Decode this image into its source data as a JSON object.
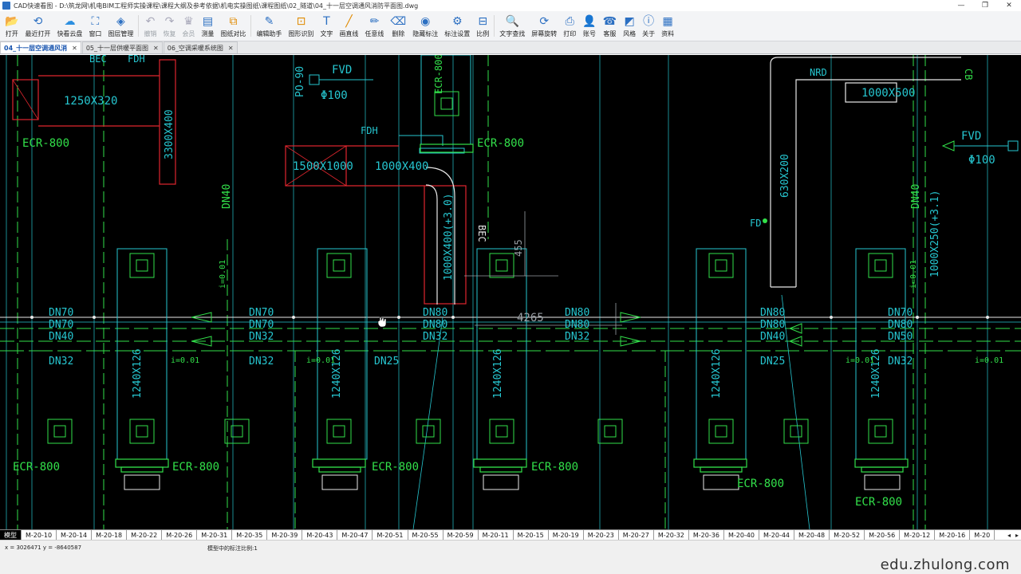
{
  "window": {
    "title": "CAD快速看图 - D:\\筑龙网\\机电BIM工程师实操课程\\课程大纲及参考依据\\机电实操图纸\\课程图纸\\02_隧道\\04_十一层空调通风消防平面图.dwg",
    "min_label": "—",
    "max_label": "❐",
    "close_label": "✕"
  },
  "toolbar": {
    "items": [
      {
        "label": "打开",
        "icon": "folder-icon",
        "glyph": "📂",
        "color": "#2b6fc2"
      },
      {
        "label": "最近打开",
        "icon": "history-icon",
        "glyph": "⟲",
        "color": "#2b6fc2"
      },
      {
        "label": "快看云盘",
        "icon": "cloud-icon",
        "glyph": "☁",
        "color": "#2b8fe0"
      },
      {
        "label": "窗口",
        "icon": "window-icon",
        "glyph": "⛶",
        "color": "#2b6fc2"
      },
      {
        "label": "图层管理",
        "icon": "layers-icon",
        "glyph": "◈",
        "color": "#2b6fc2"
      },
      {
        "label": "撤销",
        "icon": "undo-icon",
        "glyph": "↶",
        "color": "#999",
        "disabled": true
      },
      {
        "label": "恢复",
        "icon": "redo-icon",
        "glyph": "↷",
        "color": "#999",
        "disabled": true
      },
      {
        "label": "会员",
        "icon": "vip-icon",
        "glyph": "♛",
        "color": "#d99a00",
        "disabled": true
      },
      {
        "label": "测量",
        "icon": "measure-icon",
        "glyph": "▤",
        "color": "#2b6fc2"
      },
      {
        "label": "图纸对比",
        "icon": "compare-icon",
        "glyph": "⧉",
        "color": "#e08a00"
      },
      {
        "label": "编辑助手",
        "icon": "edit-assistant-icon",
        "glyph": "✎",
        "color": "#2b6fc2"
      },
      {
        "label": "图形识别",
        "icon": "recognize-icon",
        "glyph": "⊡",
        "color": "#e08a00"
      },
      {
        "label": "文字",
        "icon": "text-icon",
        "glyph": "T",
        "color": "#2b6fc2"
      },
      {
        "label": "画直线",
        "icon": "line-icon",
        "glyph": "╱",
        "color": "#e08a00"
      },
      {
        "label": "任意线",
        "icon": "freehand-icon",
        "glyph": "✏",
        "color": "#2b6fc2"
      },
      {
        "label": "删除",
        "icon": "eraser-icon",
        "glyph": "⌫",
        "color": "#2b6fc2"
      },
      {
        "label": "隐藏标注",
        "icon": "hide-annotation-icon",
        "glyph": "◉",
        "color": "#2b6fc2"
      },
      {
        "label": "标注设置",
        "icon": "annotation-settings-icon",
        "glyph": "⚙",
        "color": "#2b6fc2"
      },
      {
        "label": "比例",
        "icon": "scale-icon",
        "glyph": "⊟",
        "color": "#2b6fc2"
      },
      {
        "label": "文字查找",
        "icon": "find-text-icon",
        "glyph": "🔍",
        "color": "#2b6fc2"
      },
      {
        "label": "屏幕旋转",
        "icon": "rotate-screen-icon",
        "glyph": "⟳",
        "color": "#2b6fc2"
      },
      {
        "label": "打印",
        "icon": "print-icon",
        "glyph": "⎙",
        "color": "#2b6fc2"
      },
      {
        "label": "账号",
        "icon": "account-icon",
        "glyph": "👤",
        "color": "#2b6fc2"
      },
      {
        "label": "客服",
        "icon": "headset-icon",
        "glyph": "☎",
        "color": "#2b6fc2"
      },
      {
        "label": "风格",
        "icon": "style-icon",
        "glyph": "◩",
        "color": "#2b6fc2"
      },
      {
        "label": "关于",
        "icon": "info-icon",
        "glyph": "ⓘ",
        "color": "#2b6fc2"
      },
      {
        "label": "资料",
        "icon": "resources-icon",
        "glyph": "▦",
        "color": "#2b6fc2"
      }
    ]
  },
  "doc_tabs": [
    {
      "label": "04_十一层空调通风消",
      "active": true,
      "close": "✕"
    },
    {
      "label": "05_十一层供暖平面图",
      "active": false,
      "close": "✕"
    },
    {
      "label": "06_空调采暖系统图",
      "active": false,
      "close": "✕"
    }
  ],
  "drawing": {
    "labels": {
      "ecr800": "ECR-800",
      "fvd": "FVD",
      "phi100": "Φ100",
      "po90": "PO-90",
      "fdh": "FDH",
      "bec": "BEC",
      "duct_1250x320": "1250X320",
      "duct_3300x400": "3300X400",
      "duct_1500x1000": "1500X1000",
      "duct_1000x400": "1000X400",
      "duct_1000x400_riser": "1000X400(+3.0)",
      "duct_630x200": "630X200",
      "duct_1000x500": "1000X500",
      "duct_1000x250": "1000X250(+3.1)",
      "duct_1240x126": "1240X126",
      "nrd": "NRD",
      "fd": "FD",
      "dn70": "DN70",
      "dn80": "DN80",
      "dn40": "DN40",
      "dn32": "DN32",
      "dn25": "DN25",
      "dn50": "DN50",
      "slope": "i=0.01",
      "dim_4265": "4265",
      "dim_455": "455",
      "marker_cb": "CB",
      "marker_bec": "BEC"
    }
  },
  "layout_tabs": [
    "模型",
    "M-20-10",
    "M-20-14",
    "M-20-18",
    "M-20-22",
    "M-20-26",
    "M-20-31",
    "M-20-35",
    "M-20-39",
    "M-20-43",
    "M-20-47",
    "M-20-51",
    "M-20-55",
    "M-20-59",
    "M-20-11",
    "M-20-15",
    "M-20-19",
    "M-20-23",
    "M-20-27",
    "M-20-32",
    "M-20-36",
    "M-20-40",
    "M-20-44",
    "M-20-48",
    "M-20-52",
    "M-20-56",
    "M-20-12",
    "M-20-16",
    "M-20"
  ],
  "layout_nav": {
    "prev": "◂",
    "next": "▸"
  },
  "status": {
    "coords": "x = 3026471   y = -8640587",
    "scale": "模型中的标注比例:1"
  },
  "watermark": "edu.zhulong.com",
  "colors": {
    "cyan": "#26c6d0",
    "green": "#32e04a",
    "red": "#e0262e",
    "white": "#e8e8e8",
    "grey": "#9aa0a6"
  }
}
